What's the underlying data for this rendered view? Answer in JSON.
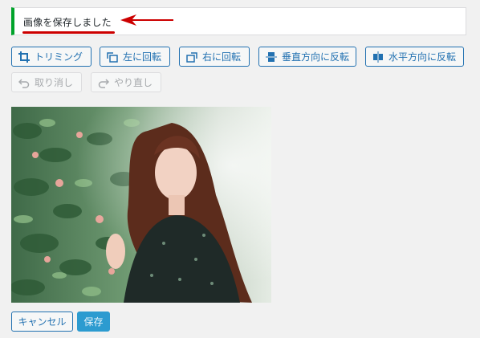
{
  "notice": {
    "message": "画像を保存しました"
  },
  "toolbar": {
    "crop": "トリミング",
    "rotate_left": "左に回転",
    "rotate_right": "右に回転",
    "flip_vertical": "垂直方向に反転",
    "flip_horizontal": "水平方向に反転",
    "undo": "取り消し",
    "redo": "やり直し"
  },
  "actions": {
    "cancel": "キャンセル",
    "save": "保存"
  },
  "colors": {
    "accent": "#2271b1",
    "success": "#00a32a",
    "annotation": "#cc0000",
    "primary": "#2c9bd0"
  },
  "icons": [
    "crop-icon",
    "rotate-left-icon",
    "rotate-right-icon",
    "flip-vertical-icon",
    "flip-horizontal-icon",
    "undo-icon",
    "redo-icon"
  ]
}
